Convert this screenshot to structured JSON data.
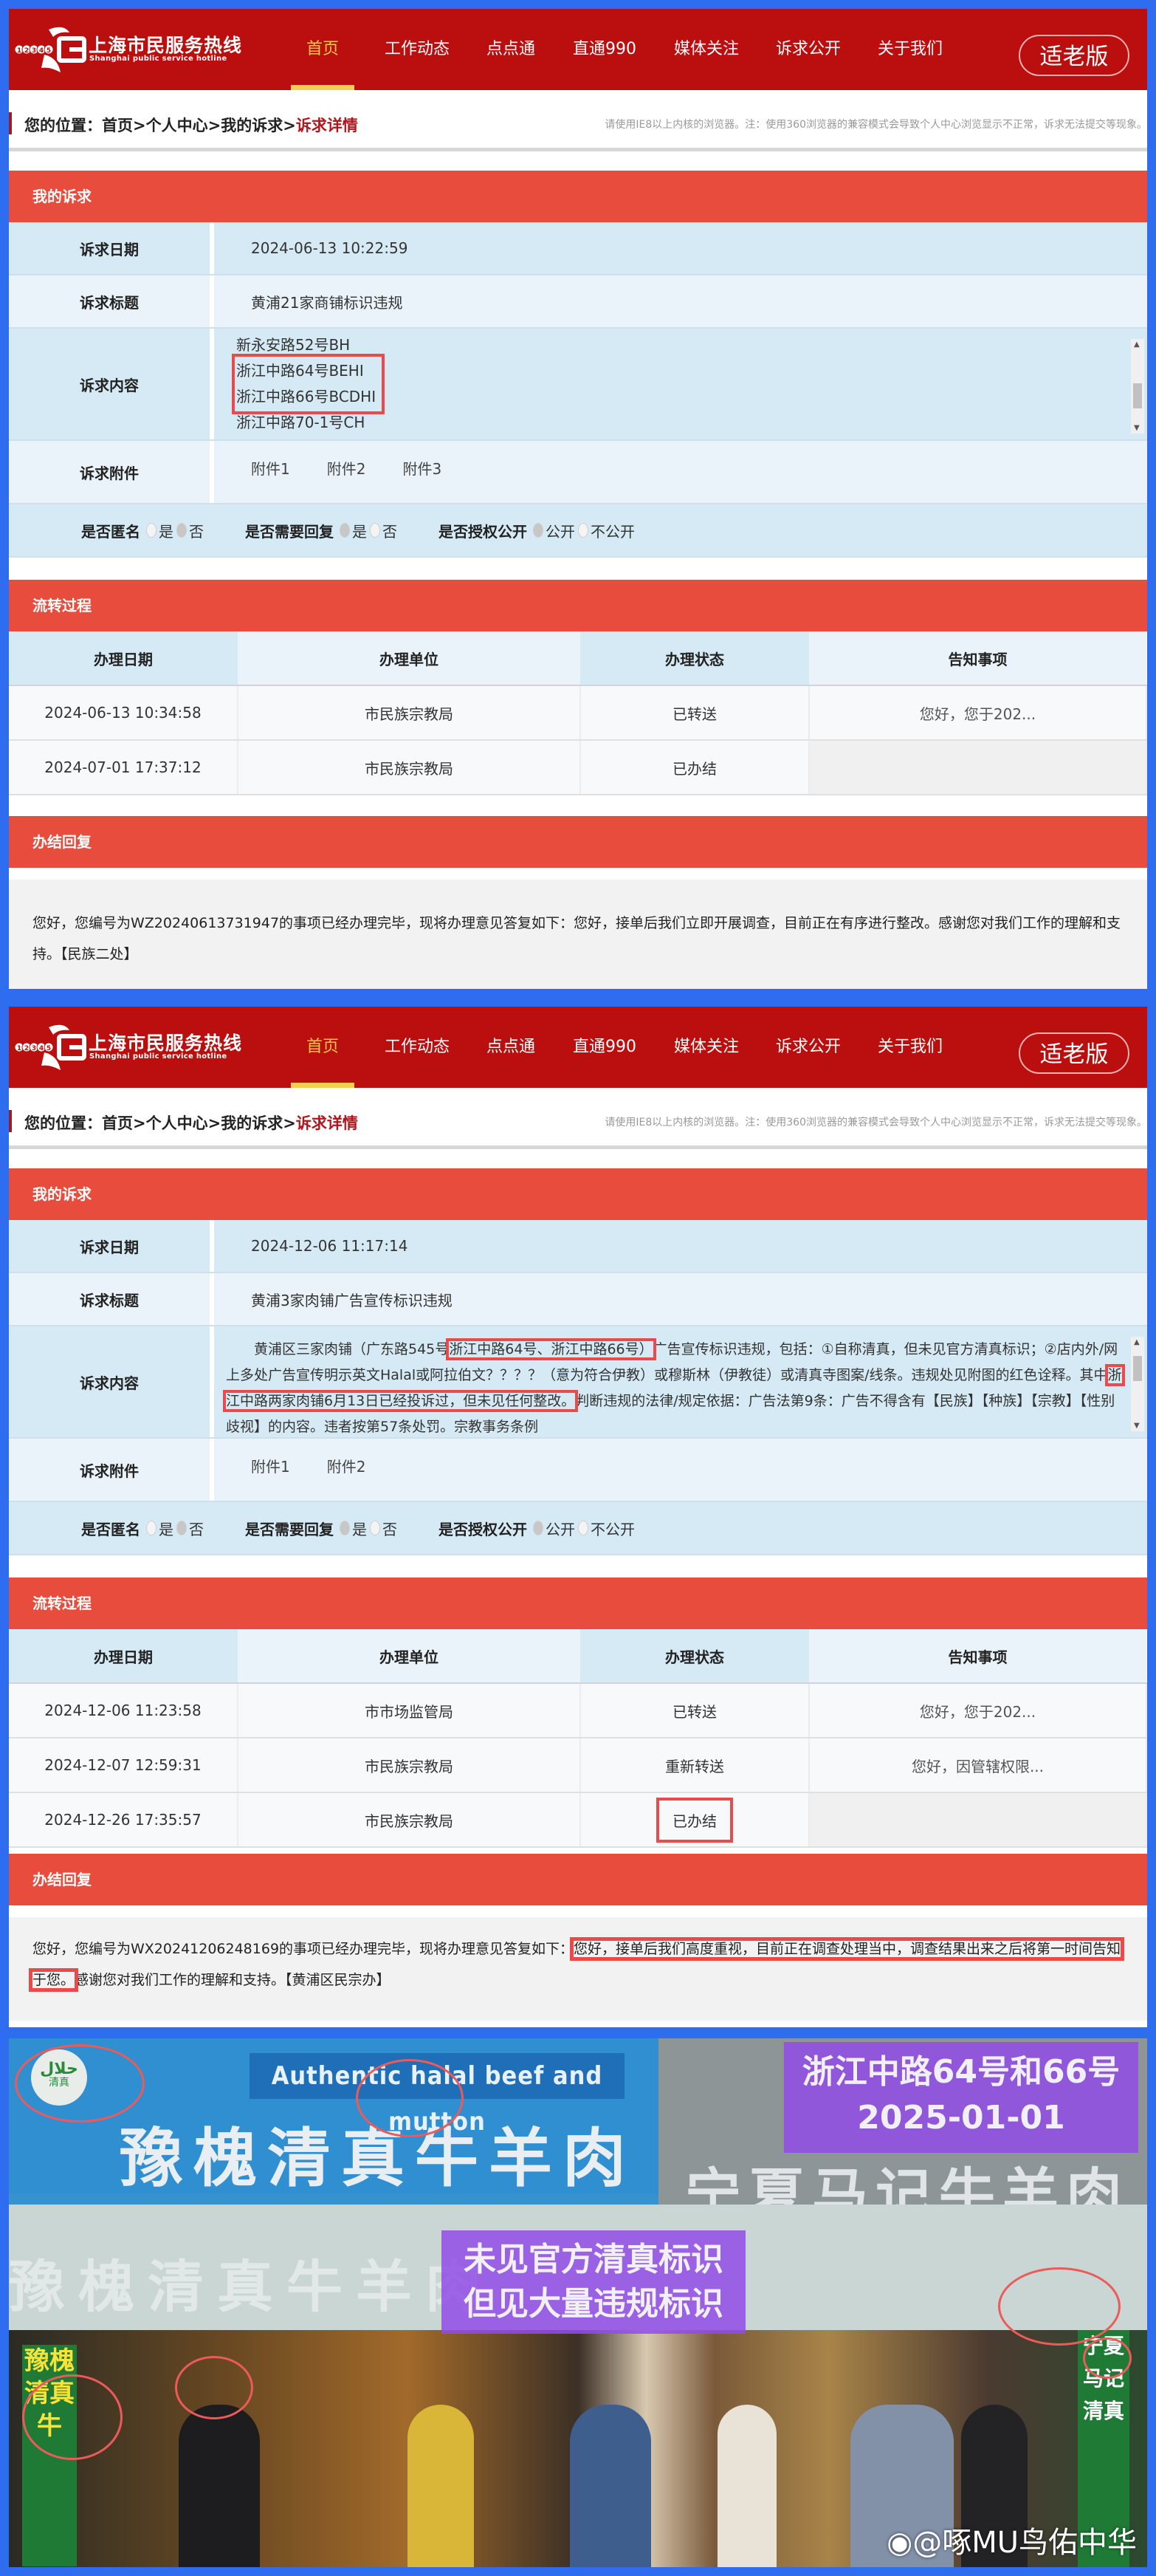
{
  "site": {
    "logo_title": "上海市民服务热线",
    "logo_subtitle": "Shanghai public service hotline",
    "logo_number": "12345",
    "nav": [
      "首页",
      "工作动态",
      "点点通",
      "直通990",
      "媒体关注",
      "诉求公开",
      "关于我们"
    ],
    "nav_active": "首页",
    "elderly_version_button": "适老版",
    "breadcrumb_prefix": "您的位置：",
    "breadcrumb": [
      "首页",
      "个人中心",
      "我的诉求"
    ],
    "breadcrumb_separator": ">",
    "breadcrumb_current": "诉求详情",
    "browser_note": "请使用IE8以上内核的浏览器。注：使用360浏览器的兼容模式会导致个人中心浏览显示不正常，诉求无法提交等现象。"
  },
  "labels": {
    "my_appeal": "我的诉求",
    "appeal_date": "诉求日期",
    "appeal_title": "诉求标题",
    "appeal_content": "诉求内容",
    "appeal_attachments": "诉求附件",
    "anonymous": "是否匿名",
    "need_reply": "是否需要回复",
    "authorize_public": "是否授权公开",
    "yes": "是",
    "no": "否",
    "public": "公开",
    "not_public": "不公开",
    "flow_process": "流转过程",
    "flow_headers": [
      "办理日期",
      "办理单位",
      "办理状态",
      "告知事项"
    ],
    "final_reply": "办结回复"
  },
  "appeals": [
    {
      "date": "2024-06-13 10:22:59",
      "title": "黄浦21家商铺标识违规",
      "content_lines": [
        "新永安路52号BH",
        "浙江中路64号BEHI",
        "浙江中路66号BCDHI",
        "浙江中路70-1号CH"
      ],
      "highlighted_lines": [
        "浙江中路64号BEHI",
        "浙江中路66号BCDHI"
      ],
      "attachments": [
        "附件1",
        "附件2",
        "附件3"
      ],
      "anonymous": "否",
      "need_reply": "是",
      "authorize_public": "公开",
      "flow": [
        {
          "date": "2024-06-13 10:34:58",
          "unit": "市民族宗教局",
          "status": "已转送",
          "notice": "您好，您于202..."
        },
        {
          "date": "2024-07-01 17:37:12",
          "unit": "市民族宗教局",
          "status": "已办结",
          "notice": ""
        }
      ],
      "reply": "您好，您编号为WZ20240613731947的事项已经办理完毕，现将办理意见答复如下：您好，接单后我们立即开展调查，目前正在有序进行整改。感谢您对我们工作的理解和支持。【民族二处】"
    },
    {
      "date": "2024-12-06 11:17:14",
      "title": "黄浦3家肉铺广告宣传标识违规",
      "content_parts": {
        "p1": "黄浦区三家肉铺（广东路545号",
        "hl1": "浙江中路64号、浙江中路66号）",
        "p2": "广告宣传标识违规，包括：①自称清真，但未见官方清真标识；②店内外/网上多处广告宣传明示英文Halal或阿拉伯文？？？？（意为符合伊教）或穆斯林（伊教徒）或清真寺图案/线条。违规处见附图的红色诠释。其中",
        "hl2": "浙江中路两家肉铺6月13日已经投诉过，但未见任何整改。",
        "p3": "判断违规的法律/规定依据：广告法第9条：广告不得含有【民族】【种族】【宗教】【性别歧视】的内容。违者按第57条处罚。宗教事务条例"
      },
      "attachments": [
        "附件1",
        "附件2"
      ],
      "anonymous": "否",
      "need_reply": "是",
      "authorize_public": "公开",
      "flow": [
        {
          "date": "2024-12-06 11:23:58",
          "unit": "市市场监管局",
          "status": "已转送",
          "notice": "您好，您于202..."
        },
        {
          "date": "2024-12-07 12:59:31",
          "unit": "市民族宗教局",
          "status": "重新转送",
          "notice": "您好，因管辖权限..."
        },
        {
          "date": "2024-12-26 17:35:57",
          "unit": "市民族宗教局",
          "status": "已办结",
          "notice": ""
        }
      ],
      "highlighted_status": "已办结",
      "reply_parts": {
        "p1": "您好，您编号为WX20241206248169的事项已经办理完毕，现将办理意见答复如下：",
        "hl1": "您好，接单后我们高度重视，目前正在调查处理当中，调查结果出来之后将第一时间告知于您。",
        "p2": "感谢您对我们工作的理解和支持。【黄浦区民宗办】"
      }
    }
  ],
  "photo": {
    "caption_location": "浙江中路64号和66号",
    "caption_date": "2025-01-01",
    "caption_note_line1": "未见官方清真标识",
    "caption_note_line2": "但见大量违规标识",
    "sign_english": "Authentic halal beef and mutton",
    "sign_left": "豫槐清真牛羊肉",
    "sign_right": "宁夏马记牛羊肉",
    "halal_badge": "清真",
    "post_left": "豫槐清真牛",
    "post_right": "宁夏马记清真",
    "watermark": "@啄MU鸟佑中华"
  },
  "colors": {
    "frame_blue": "#2f6df0",
    "header_red": "#bb0e0e",
    "section_red": "#e84c3d",
    "nav_active": "#f5c84a",
    "annotation_red": "#ec4a4a",
    "caption_purple": "#924ce6"
  }
}
